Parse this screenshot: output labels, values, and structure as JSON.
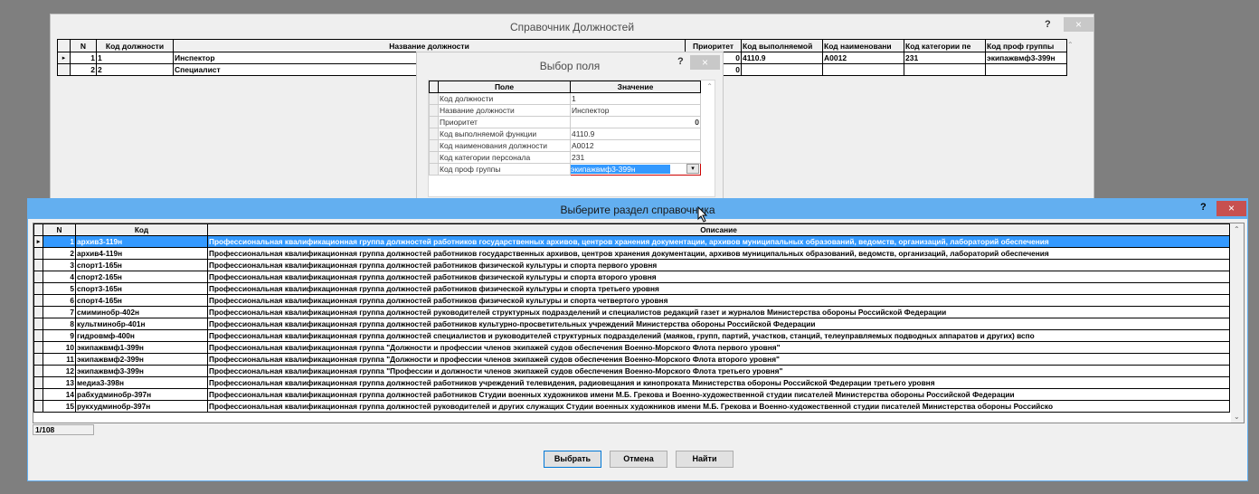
{
  "main_window": {
    "title": "Справочник Должностей",
    "help_label": "?",
    "close_label": "×",
    "columns": [
      "N",
      "Код должности",
      "Название должности",
      "Приоритет",
      "Код выполняемой",
      "Код наименовани",
      "Код категории пе",
      "Код проф группы"
    ],
    "rows": [
      {
        "n": "1",
        "code": "1",
        "name": "Инспектор",
        "priority": "0",
        "func_code": "4110.9",
        "name_code": "A0012",
        "cat_code": "231",
        "prof_group": "экипажвмф3-399н"
      },
      {
        "n": "2",
        "code": "2",
        "name": "Специалист",
        "priority": "0",
        "func_code": "",
        "name_code": "",
        "cat_code": "",
        "prof_group": ""
      }
    ]
  },
  "field_dialog": {
    "title": "Выбор поля",
    "help_label": "?",
    "close_label": "×",
    "columns": [
      "Поле",
      "Значение"
    ],
    "rows": [
      {
        "field": "Код должности",
        "value": "1"
      },
      {
        "field": "Название должности",
        "value": "Инспектор"
      },
      {
        "field": "Приоритет",
        "value": "0"
      },
      {
        "field": "Код выполняемой функции",
        "value": "4110.9"
      },
      {
        "field": "Код наименования должности",
        "value": "A0012"
      },
      {
        "field": "Код категории персонала",
        "value": "231"
      },
      {
        "field": "Код проф группы",
        "value": "экипажвмф3-399н"
      }
    ]
  },
  "section_dialog": {
    "title": "Выберите раздел справочника",
    "help_label": "?",
    "close_label": "×",
    "columns": [
      "N",
      "Код",
      "Описание"
    ],
    "rows": [
      {
        "n": "1",
        "code": "архив3-119н",
        "desc": "Профессиональная квалификационная группа должностей работников государственных архивов, центров хранения документации, архивов муниципальных образований, ведомств, организаций, лабораторий обеспечения"
      },
      {
        "n": "2",
        "code": "архив4-119н",
        "desc": "Профессиональная квалификационная группа должностей работников государственных архивов, центров хранения документации, архивов муниципальных образований, ведомств, организаций, лабораторий обеспечения"
      },
      {
        "n": "3",
        "code": "спорт1-165н",
        "desc": "Профессиональная квалификационная группа должностей работников физической культуры и спорта первого уровня"
      },
      {
        "n": "4",
        "code": "спорт2-165н",
        "desc": "Профессиональная квалификационная группа должностей работников физической культуры и спорта второго уровня"
      },
      {
        "n": "5",
        "code": "спорт3-165н",
        "desc": "Профессиональная квалификационная группа должностей работников физической культуры и спорта третьего уровня"
      },
      {
        "n": "6",
        "code": "спорт4-165н",
        "desc": "Профессиональная квалификационная группа должностей работников физической культуры и спорта четвертого уровня"
      },
      {
        "n": "7",
        "code": "смиминобр-402н",
        "desc": "Профессиональная квалификационная группа должностей руководителей структурных подразделений и специалистов редакций газет и журналов Министерства обороны Российской Федерации"
      },
      {
        "n": "8",
        "code": "культминобр-401н",
        "desc": "Профессиональная квалификационная группа должностей работников культурно-просветительных учреждений Министерства обороны Российской Федерации"
      },
      {
        "n": "9",
        "code": "гидровмф-400н",
        "desc": "Профессиональная квалификационная группа должностей специалистов и руководителей структурных подразделений (маяков, групп, партий, участков, станций, телеуправляемых подводных аппаратов и других) вспо"
      },
      {
        "n": "10",
        "code": "экипажвмф1-399н",
        "desc": "Профессиональная квалификационная группа \"Должности и профессии членов экипажей судов обеспечения Военно-Морского Флота первого уровня\""
      },
      {
        "n": "11",
        "code": "экипажвмф2-399н",
        "desc": "Профессиональная квалификационная группа \"Должности и профессии членов экипажей судов обеспечения Военно-Морского Флота второго уровня\""
      },
      {
        "n": "12",
        "code": "экипажвмф3-399н",
        "desc": "Профессиональная квалификационная группа \"Профессии и должности членов экипажей судов обеспечения Военно-Морского Флота третьего уровня\""
      },
      {
        "n": "13",
        "code": "медиа3-398н",
        "desc": "Профессиональная квалификационная группа должностей работников учреждений телевидения, радиовещания и кинопроката Министерства обороны Российской Федерации третьего уровня"
      },
      {
        "n": "14",
        "code": "рабхудминобр-397н",
        "desc": "Профессиональная квалификационная группа должностей работников Студии военных художников имени М.Б. Грекова и Военно-художественной студии писателей Министерства обороны Российской Федерации"
      },
      {
        "n": "15",
        "code": "рукхудминобр-397н",
        "desc": "Профессиональная квалификационная группа должностей руководителей и других служащих Студии военных художников имени М.Б. Грекова и Военно-художественной студии писателей Министерства обороны Российско"
      }
    ],
    "record_counter": "1/108",
    "buttons": {
      "select": "Выбрать",
      "cancel": "Отмена",
      "find": "Найти"
    }
  },
  "colors": {
    "active_titlebar": "#63aff0",
    "close_red": "#c75050",
    "selection": "#3399ff"
  }
}
